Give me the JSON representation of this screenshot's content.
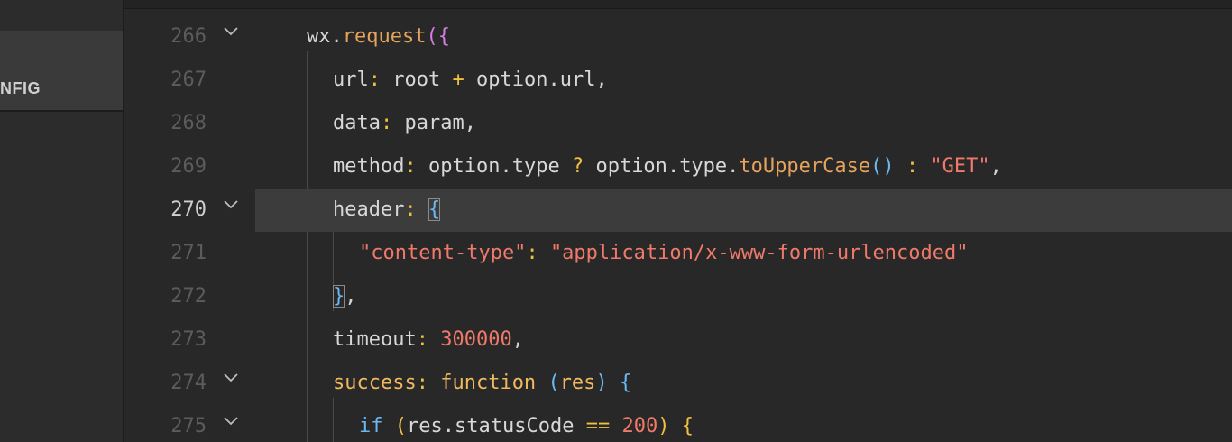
{
  "sidebar": {
    "panel_label": "NFIG"
  },
  "lines": [
    {
      "num": "266",
      "fold": true
    },
    {
      "num": "267",
      "fold": false
    },
    {
      "num": "268",
      "fold": false
    },
    {
      "num": "269",
      "fold": false
    },
    {
      "num": "270",
      "fold": true
    },
    {
      "num": "271",
      "fold": false
    },
    {
      "num": "272",
      "fold": false
    },
    {
      "num": "273",
      "fold": false
    },
    {
      "num": "274",
      "fold": true
    },
    {
      "num": "275",
      "fold": true
    }
  ],
  "code": {
    "l266": {
      "obj": "wx",
      "dot": ".",
      "fn": "request",
      "open": "(",
      "brace": "{"
    },
    "l267": {
      "key": "url",
      "colon": ":",
      "a": "root",
      "op": "+",
      "b": "option",
      "dot": ".",
      "c": "url",
      "comma": ","
    },
    "l268": {
      "key": "data",
      "colon": ":",
      "a": "param",
      "comma": ","
    },
    "l269": {
      "key": "method",
      "colon": ":",
      "a": "option",
      "dot1": ".",
      "b": "type",
      "q": "?",
      "c": "option",
      "dot2": ".",
      "d": "type",
      "dot3": ".",
      "fn": "toUpperCase",
      "parens": "()",
      "colon2": ":",
      "str": "\"GET\"",
      "comma": ","
    },
    "l270": {
      "key": "header",
      "colon": ":",
      "brace": "{"
    },
    "l271": {
      "str1": "\"content-type\"",
      "colon": ":",
      "str2": "\"application/x-www-form-urlencoded\""
    },
    "l272": {
      "brace": "}",
      "comma": ","
    },
    "l273": {
      "key": "timeout",
      "colon": ":",
      "num": "300000",
      "comma": ","
    },
    "l274": {
      "key": "success",
      "colon": ":",
      "kw": "function",
      "open": "(",
      "arg": "res",
      "close": ")",
      "brace": "{"
    },
    "l275": {
      "kw": "if",
      "open": "(",
      "a": "res",
      "dot": ".",
      "b": "statusCode",
      "op": "==",
      "num": "200",
      "close": ")",
      "brace": "{"
    }
  }
}
